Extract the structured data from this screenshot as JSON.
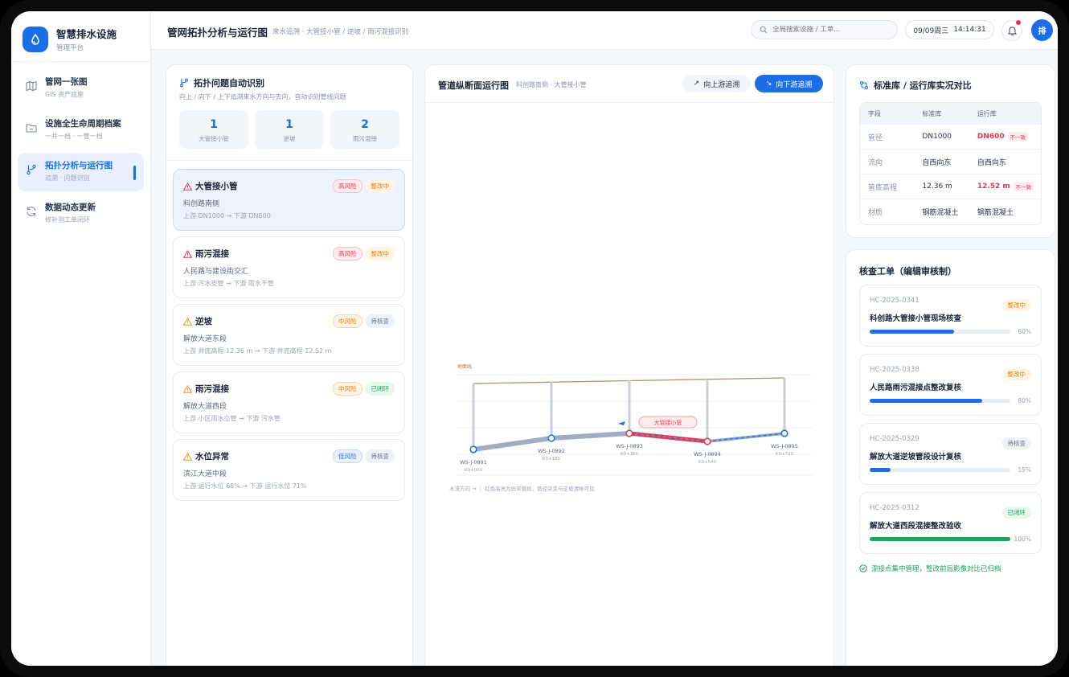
{
  "brand": {
    "title": "智慧排水设施",
    "subtitle": "管理平台"
  },
  "nav": [
    {
      "label": "管网一张图",
      "sub": "GIS 资产底座"
    },
    {
      "label": "设施全生命周期档案",
      "sub": "一井一档 · 一管一档"
    },
    {
      "label": "拓扑分析与运行图",
      "sub": "追溯 · 问题识别"
    },
    {
      "label": "数据动态更新",
      "sub": "修补测工单闭环"
    }
  ],
  "header": {
    "title": "管网拓扑分析与运行图",
    "breadcrumb": "来水追溯 · 大管接小管 / 逆坡 / 雨污混接识别",
    "search_placeholder": "全局搜索设施 / 工单...",
    "date": "09/09周三",
    "time": "14:14:31",
    "avatar": "排"
  },
  "topology": {
    "title": "拓扑问题自动识别",
    "subtitle": "向上 / 向下 / 上下追溯来水方向与去向，自动识别管线问题",
    "stats": [
      {
        "value": "1",
        "label": "大管接小管"
      },
      {
        "value": "1",
        "label": "逆坡"
      },
      {
        "value": "2",
        "label": "雨污混接"
      }
    ],
    "issues": [
      {
        "title": "大管接小管",
        "location": "科创路南侧",
        "detail": "上游 DN1000 → 下游 DN600",
        "risk": "高风险",
        "status": "整改中"
      },
      {
        "title": "雨污混接",
        "location": "人民路与建设街交汇",
        "detail": "上游 污水支管 → 下游 雨水干管",
        "risk": "高风险",
        "status": "整改中"
      },
      {
        "title": "逆坡",
        "location": "解放大道东段",
        "detail": "上游 井底高程 12.36 m → 下游 井底高程 12.52 m",
        "risk": "中风险",
        "status": "待核查"
      },
      {
        "title": "雨污混接",
        "location": "解放大道西段",
        "detail": "上游 小区雨水立管 → 下游 污水管",
        "risk": "中风险",
        "status": "已闭环"
      },
      {
        "title": "水位异常",
        "location": "滨江大道中段",
        "detail": "上游 运行水位 68% → 下游 运行水位 71%",
        "risk": "低风险",
        "status": "待核查"
      }
    ]
  },
  "profile": {
    "title": "管道纵断面运行图",
    "subtitle": "科创路南侧 · 大管接小管",
    "btn_up": "向上游追溯",
    "btn_down": "向下游追溯",
    "ground_label": "地面线",
    "anomaly_label": "大管接小管",
    "nodes": [
      {
        "id": "WS-J-0891",
        "station": "K0+000"
      },
      {
        "id": "WS-J-0892",
        "station": "K0+180"
      },
      {
        "id": "WS-J-0893",
        "station": "K0+360"
      },
      {
        "id": "WS-J-0894",
        "station": "K0+540"
      },
      {
        "id": "WS-J-0895",
        "station": "K0+720"
      }
    ],
    "note": "水流方向 → ｜ 红色高亮为异常管段，管径突变与逆坡清晰可见"
  },
  "compare": {
    "title": "标准库 / 运行库实况对比",
    "headers": [
      "字段",
      "标准库",
      "运行库"
    ],
    "rows": [
      {
        "field": "管径",
        "std": "DN1000",
        "run": "DN600",
        "flag": "不一致"
      },
      {
        "field": "流向",
        "std": "自西向东",
        "run": "自西向东",
        "flag": ""
      },
      {
        "field": "管底高程",
        "std": "12.36 m",
        "run": "12.52 m",
        "flag": "不一致"
      },
      {
        "field": "材质",
        "std": "钢筋混凝土",
        "run": "钢筋混凝土",
        "flag": ""
      }
    ]
  },
  "orders": {
    "title": "核查工单（编辑审核制）",
    "items": [
      {
        "no": "HC-2025-0341",
        "title": "科创路大管接小管现场核查",
        "status": "整改中",
        "progress": 0.6,
        "pct": "60%",
        "color": "#1a6fe8"
      },
      {
        "no": "HC-2025-0338",
        "title": "人民路雨污混接点整改复核",
        "status": "整改中",
        "progress": 0.8,
        "pct": "80%",
        "color": "#1a6fe8"
      },
      {
        "no": "HC-2025-0329",
        "title": "解放大道逆坡管段设计复核",
        "status": "待核查",
        "progress": 0.15,
        "pct": "15%",
        "color": "#1a6fe8"
      },
      {
        "no": "HC-2025-0312",
        "title": "解放大道西段混接整改验收",
        "status": "已闭环",
        "progress": 1.0,
        "pct": "100%",
        "color": "#1ba35a"
      }
    ],
    "footer": "混接点集中管理，整改前后影像对比已归档"
  }
}
